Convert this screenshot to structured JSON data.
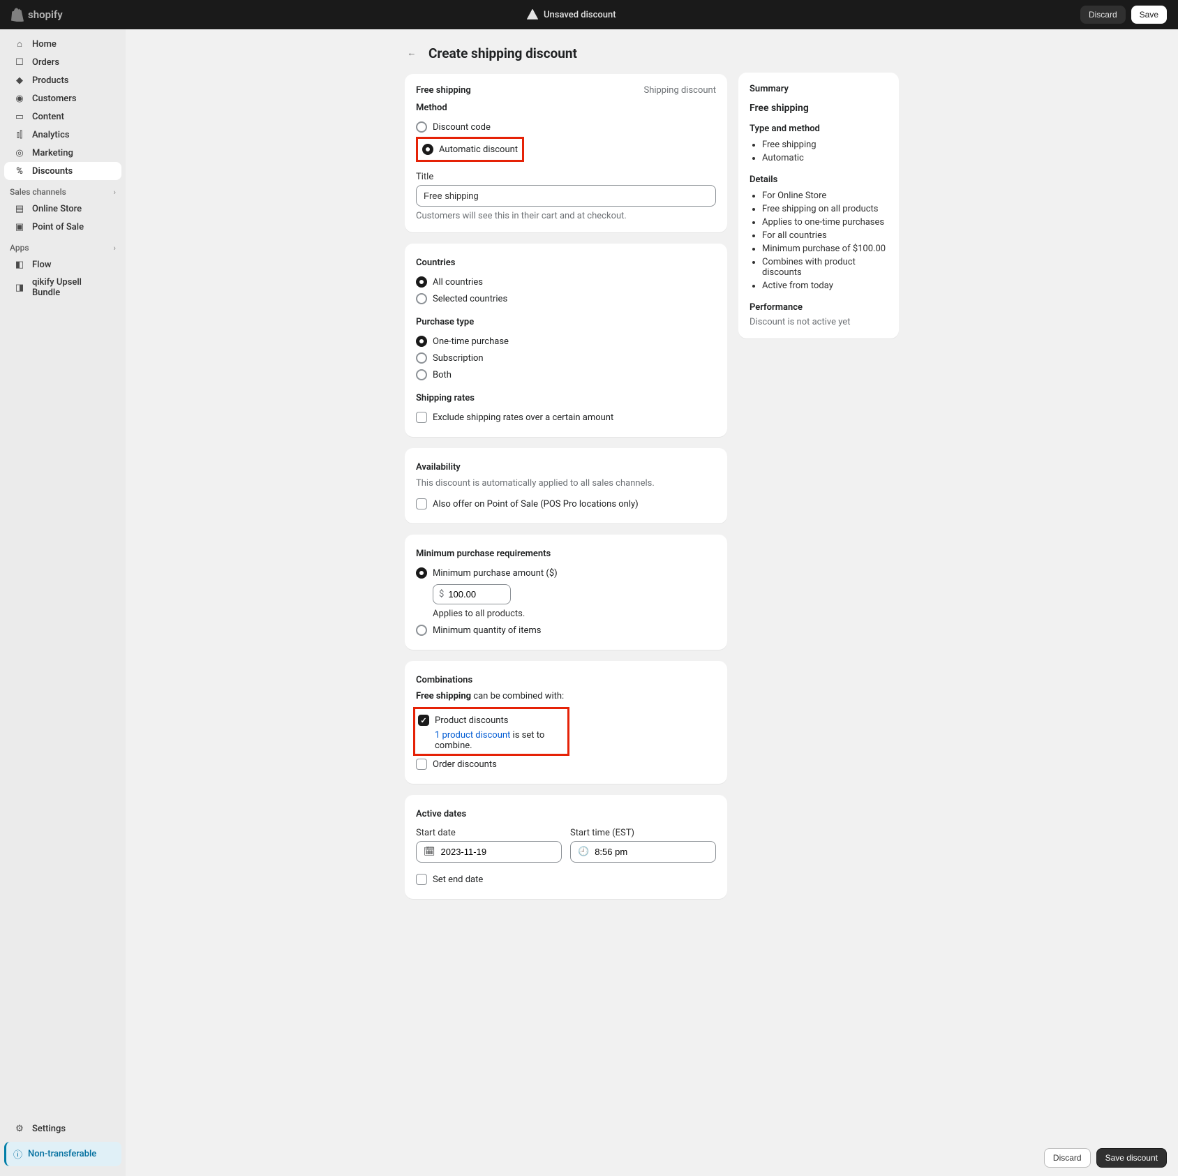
{
  "topbar": {
    "brand": "shopify",
    "status": "Unsaved discount",
    "discard": "Discard",
    "save": "Save"
  },
  "nav": {
    "home": "Home",
    "orders": "Orders",
    "products": "Products",
    "customers": "Customers",
    "content": "Content",
    "analytics": "Analytics",
    "marketing": "Marketing",
    "discounts": "Discounts",
    "sales_channels": "Sales channels",
    "online_store": "Online Store",
    "point_of_sale": "Point of Sale",
    "apps": "Apps",
    "flow": "Flow",
    "qikify": "qikify Upsell Bundle",
    "settings": "Settings",
    "non_transferable": "Non-transferable"
  },
  "page": {
    "title": "Create shipping discount"
  },
  "freeshipping": {
    "title": "Free shipping",
    "badge": "Shipping discount",
    "method_label": "Method",
    "discount_code": "Discount code",
    "automatic_discount": "Automatic discount",
    "title_label": "Title",
    "title_value": "Free shipping",
    "title_helper": "Customers will see this in their cart and at checkout."
  },
  "countries": {
    "title": "Countries",
    "all": "All countries",
    "selected": "Selected countries",
    "purchase_type": "Purchase type",
    "one_time": "One-time purchase",
    "subscription": "Subscription",
    "both": "Both",
    "shipping_rates": "Shipping rates",
    "exclude": "Exclude shipping rates over a certain amount"
  },
  "availability": {
    "title": "Availability",
    "desc": "This discount is automatically applied to all sales channels.",
    "pos": "Also offer on Point of Sale (POS Pro locations only)"
  },
  "minpurchase": {
    "title": "Minimum purchase requirements",
    "amount": "Minimum purchase amount ($)",
    "amount_value": "100.00",
    "applies": "Applies to all products.",
    "qty": "Minimum quantity of items"
  },
  "combinations": {
    "title": "Combinations",
    "intro_bold": "Free shipping",
    "intro_rest": " can be combined with:",
    "product": "Product discounts",
    "product_link": "1 product discount",
    "product_rest": " is set to combine.",
    "order": "Order discounts"
  },
  "dates": {
    "title": "Active dates",
    "start_date": "Start date",
    "start_date_value": "2023-11-19",
    "start_time": "Start time (EST)",
    "start_time_value": "8:56 pm",
    "set_end": "Set end date"
  },
  "summary": {
    "title": "Summary",
    "name": "Free shipping",
    "type_method": "Type and method",
    "details": "Details",
    "performance": "Performance",
    "perf_text": "Discount is not active yet",
    "tm": [
      "Free shipping",
      "Automatic"
    ],
    "det": [
      "For Online Store",
      "Free shipping on all products",
      "Applies to one-time purchases",
      "For all countries",
      "Minimum purchase of $100.00",
      "Combines with product discounts",
      "Active from today"
    ]
  },
  "footer": {
    "discard": "Discard",
    "save": "Save discount"
  }
}
